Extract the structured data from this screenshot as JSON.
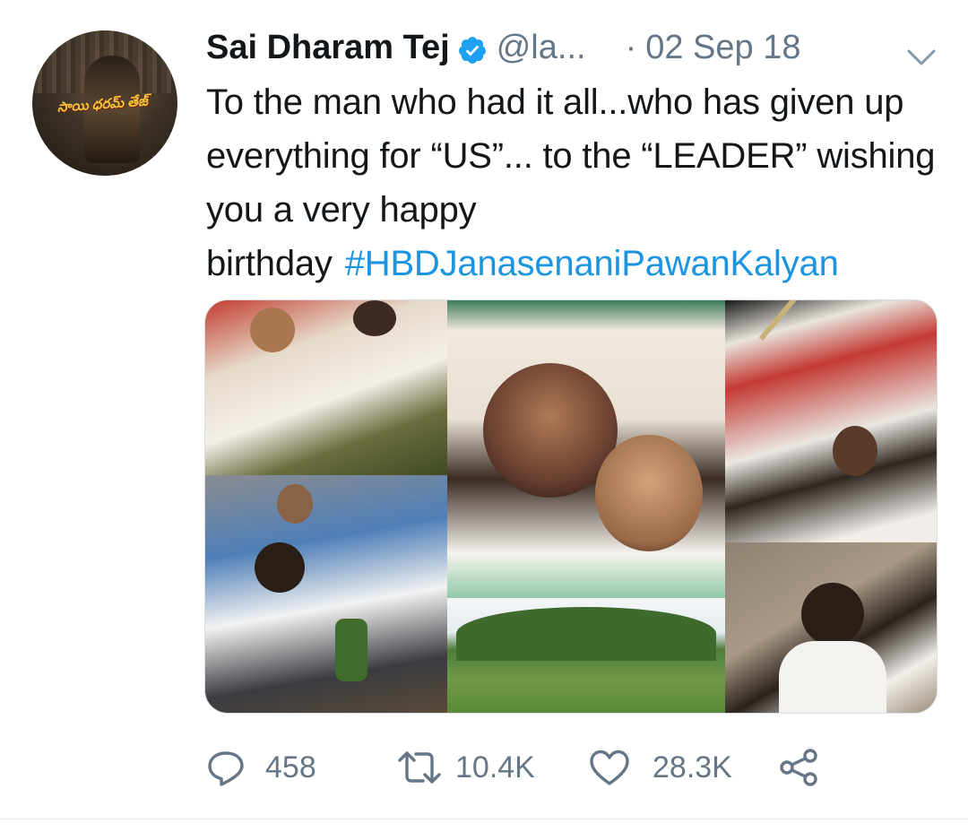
{
  "tweet": {
    "author_name": "Sai Dharam Tej",
    "handle": "@la...",
    "separator": "·",
    "date": "02 Sep 18",
    "text_main": "To the man who had it all...who has given up everything for “US”... to the “LEADER” wishing you a very happy birthday",
    "hashtag": "#HBDJanasenaniPawanKalyan",
    "avatar_text": "సాయి ధరమ్ తేజ్",
    "icons": {
      "verified": "verified-badge-icon",
      "more": "chevron-down-icon",
      "reply": "reply-icon",
      "retweet": "retweet-icon",
      "like": "heart-icon",
      "share": "share-icon"
    }
  },
  "actions": {
    "replies": "458",
    "retweets": "10.4K",
    "likes": "28.3K"
  },
  "colors": {
    "link": "#1b95e0",
    "muted": "#657786",
    "text": "#14171a",
    "verified": "#1da1f2"
  }
}
